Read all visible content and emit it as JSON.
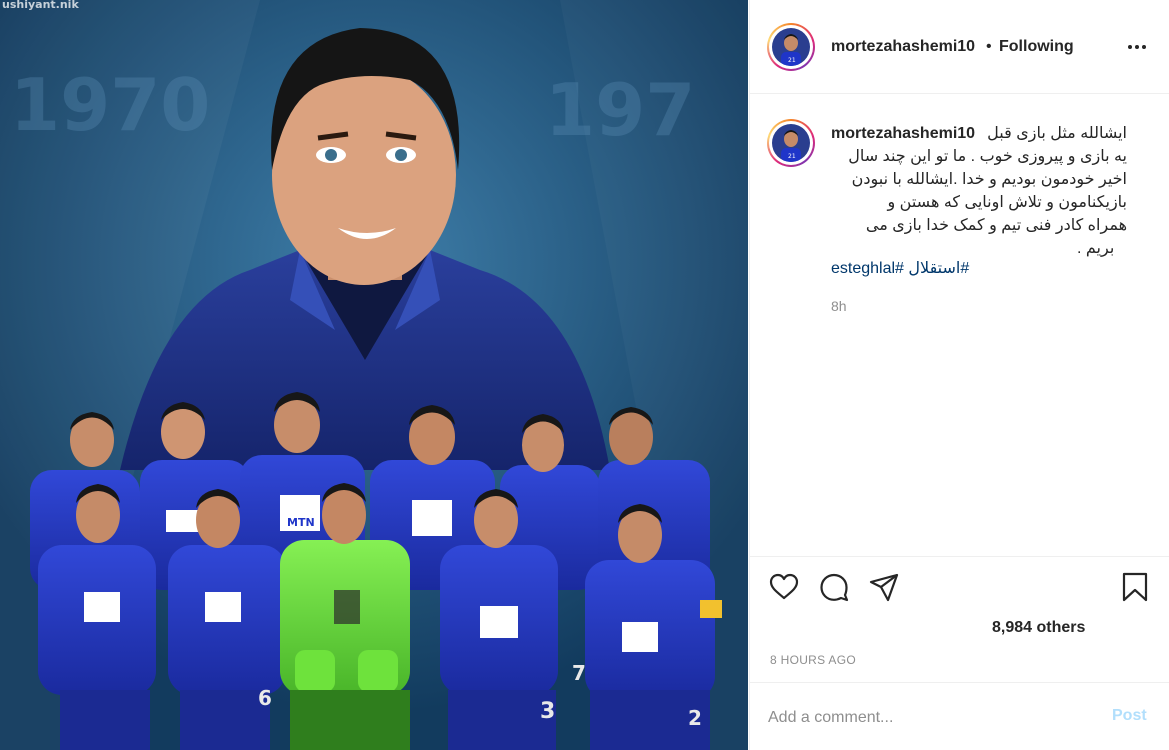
{
  "media": {
    "watermark": "ushiyant.nik",
    "background_years": [
      "1970",
      "197"
    ],
    "jersey_sponsor": "MTN",
    "jersey_numbers": [
      "3",
      "7",
      "6",
      "2"
    ]
  },
  "post": {
    "author": "mortezahashemi10",
    "separator": "•",
    "follow_status": "Following",
    "more_icon": "more-options-icon",
    "caption_lines": [
      "ایشالله مثل بازی قبل",
      "یه بازی و پیروزی خوب . ما تو این چند سال",
      "اخیر خودمون بودیم و خدا .ایشالله با نبودن",
      "بازیکنامون و تلاش اونایی که هستن و",
      "همراه کادر فنی تیم و کمک خدا بازی می",
      "بریم ."
    ],
    "hashtags": [
      "#استقلال",
      "#esteghlal"
    ],
    "time_ago": "8h",
    "likes": "8,984 others",
    "date": "8 HOURS AGO"
  },
  "comment_box": {
    "placeholder": "Add a comment...",
    "post_label": "Post"
  },
  "colors": {
    "link": "#00376b",
    "secondary_text": "#8e8e8e",
    "post_button": "#b2dffc",
    "border": "#efefef",
    "jersey_blue": "#1f35c9",
    "keeper_green": "#6ee23c"
  }
}
